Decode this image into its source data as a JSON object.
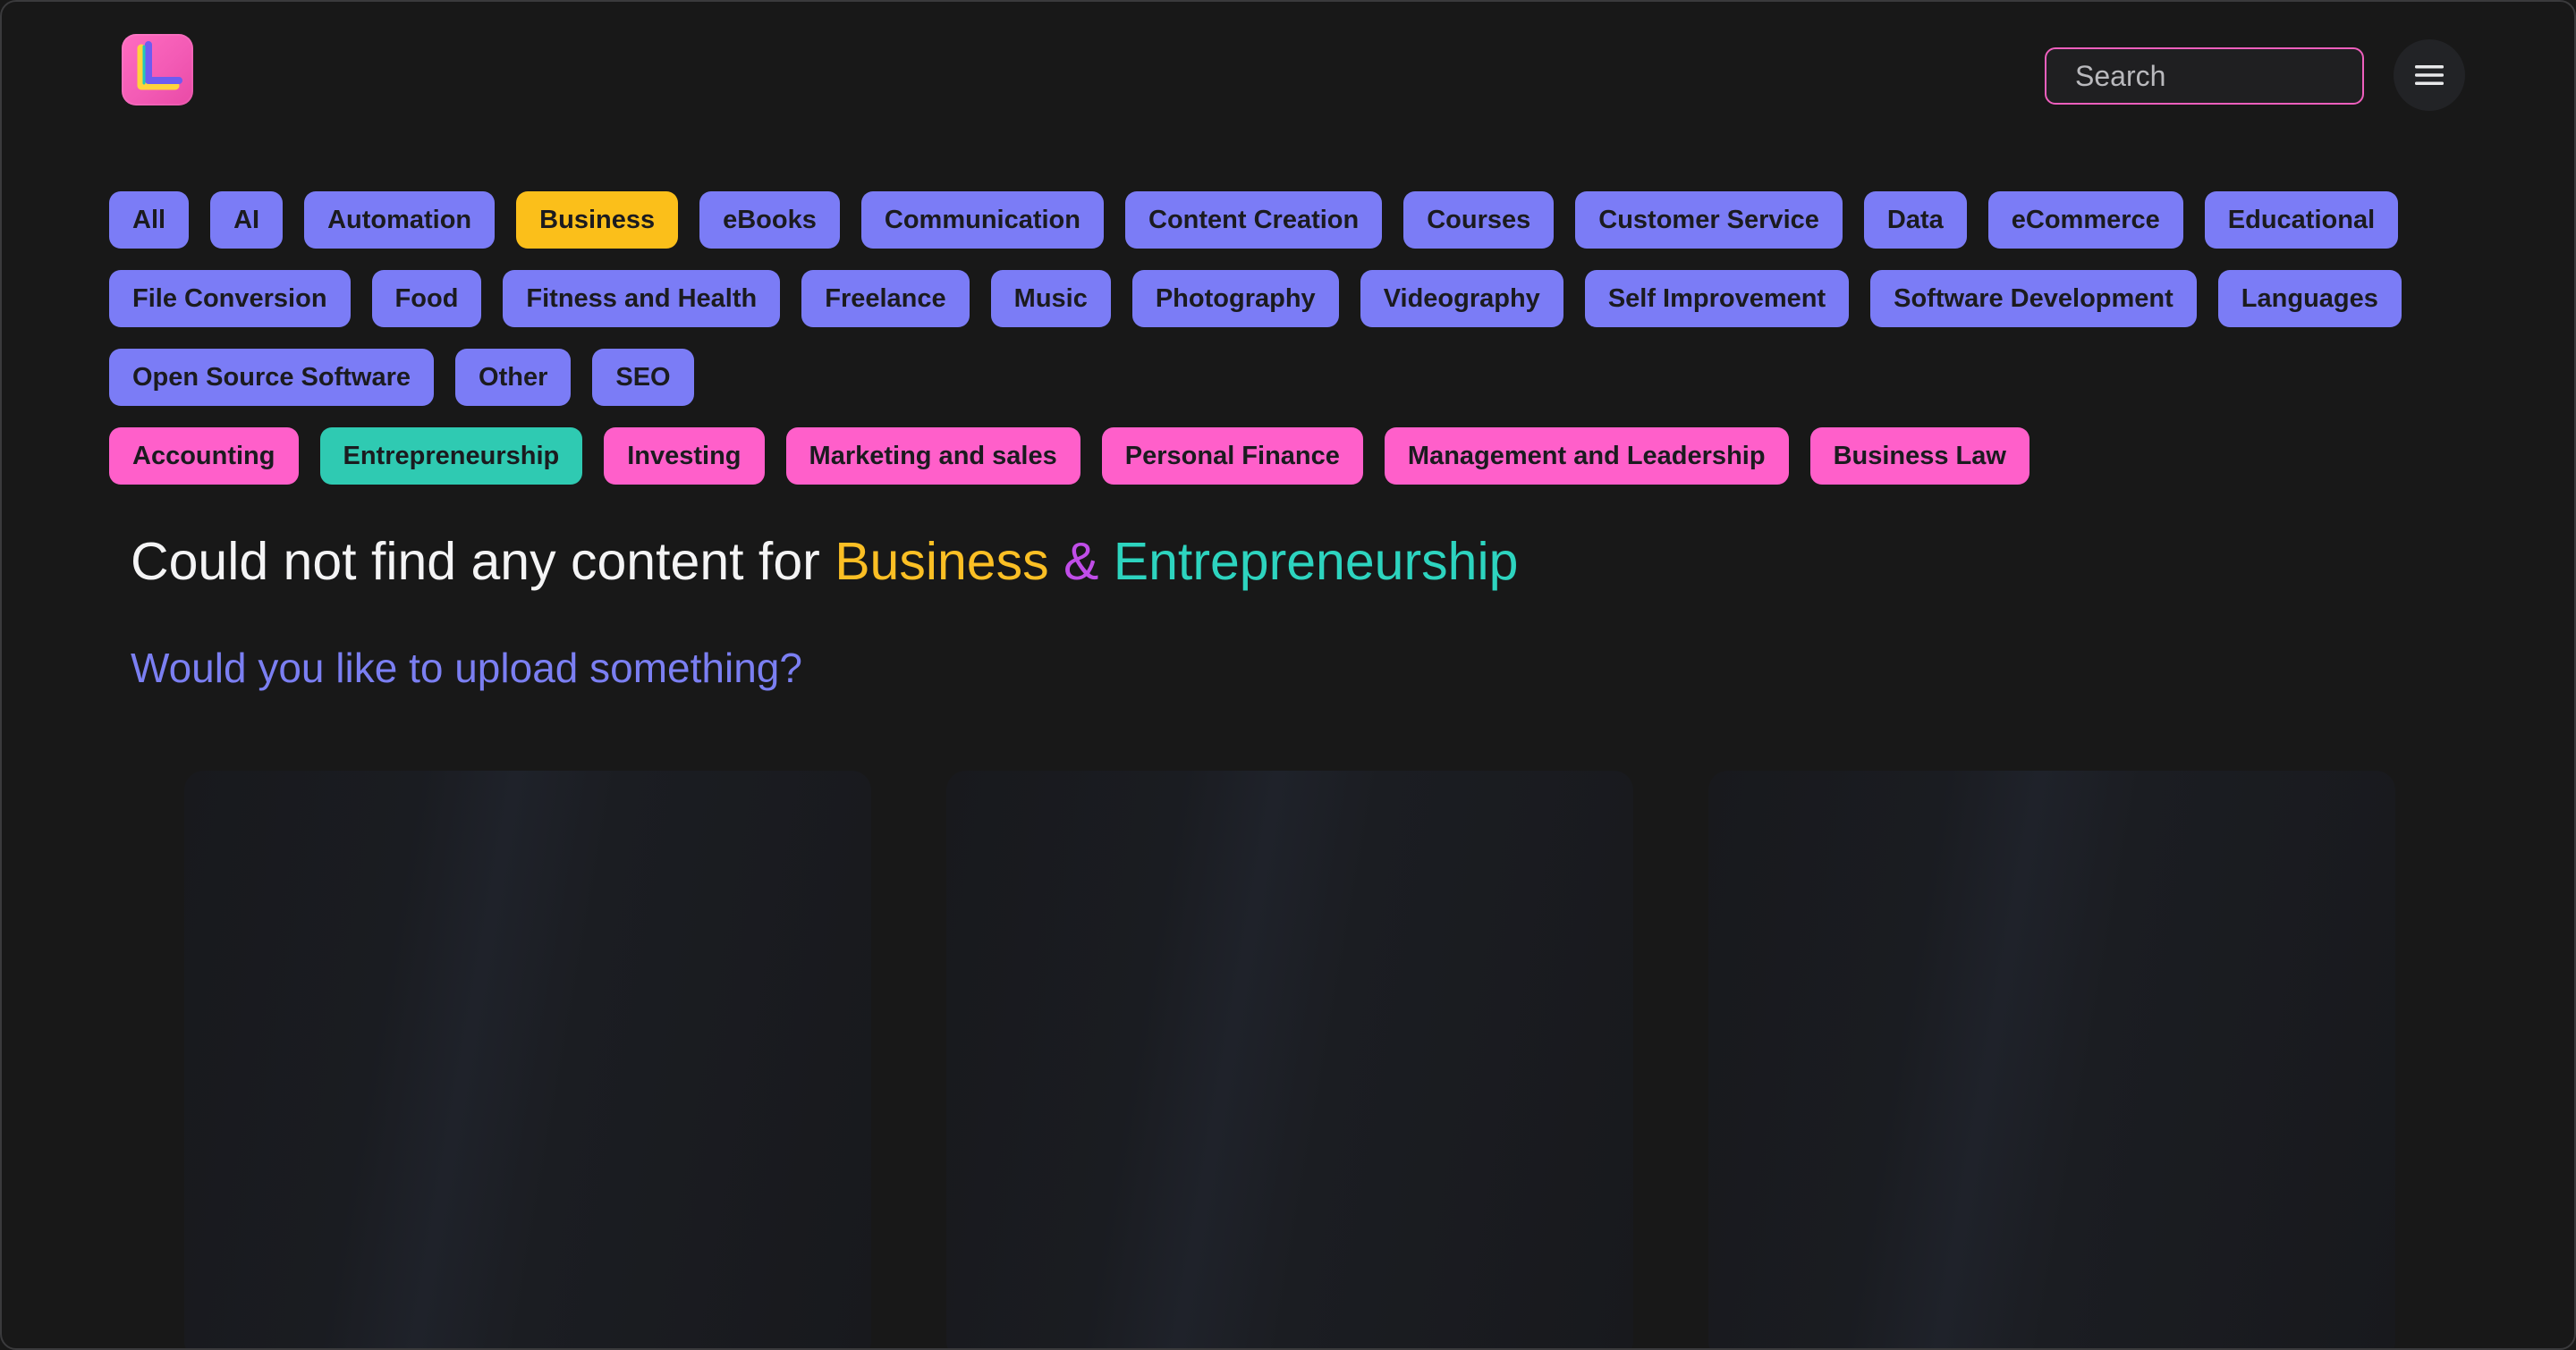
{
  "header": {
    "logo_letter": "L",
    "search": {
      "placeholder": "Search",
      "value": ""
    },
    "menu_icon": "hamburger-menu-icon"
  },
  "category_rows": [
    [
      {
        "label": "All",
        "state": "default"
      },
      {
        "label": "AI",
        "state": "default"
      },
      {
        "label": "Automation",
        "state": "default"
      },
      {
        "label": "Business",
        "state": "selected"
      },
      {
        "label": "eBooks",
        "state": "default"
      },
      {
        "label": "Communication",
        "state": "default"
      },
      {
        "label": "Content Creation",
        "state": "default"
      },
      {
        "label": "Courses",
        "state": "default"
      },
      {
        "label": "Customer Service",
        "state": "default"
      },
      {
        "label": "Data",
        "state": "default"
      },
      {
        "label": "eCommerce",
        "state": "default"
      },
      {
        "label": "Educational",
        "state": "default"
      }
    ],
    [
      {
        "label": "File Conversion",
        "state": "default"
      },
      {
        "label": "Food",
        "state": "default"
      },
      {
        "label": "Fitness and Health",
        "state": "default"
      },
      {
        "label": "Freelance",
        "state": "default"
      },
      {
        "label": "Music",
        "state": "default"
      },
      {
        "label": "Photography",
        "state": "default"
      },
      {
        "label": "Videography",
        "state": "default"
      },
      {
        "label": "Self Improvement",
        "state": "default"
      },
      {
        "label": "Software Development",
        "state": "default"
      },
      {
        "label": "Languages",
        "state": "default"
      }
    ],
    [
      {
        "label": "Open Source Software",
        "state": "default"
      },
      {
        "label": "Other",
        "state": "default"
      },
      {
        "label": "SEO",
        "state": "default"
      }
    ]
  ],
  "subcategories": [
    {
      "label": "Accounting",
      "state": "default"
    },
    {
      "label": "Entrepreneurship",
      "state": "selected"
    },
    {
      "label": "Investing",
      "state": "default"
    },
    {
      "label": "Marketing and sales",
      "state": "default"
    },
    {
      "label": "Personal Finance",
      "state": "default"
    },
    {
      "label": "Management and Leadership",
      "state": "default"
    },
    {
      "label": "Business Law",
      "state": "default"
    }
  ],
  "empty_state": {
    "prefix": "Could not find any content for",
    "category": "Business",
    "ampersand": "&",
    "subcategory": "Entrepreneurship",
    "upload_prompt": "Would you like to upload something?"
  },
  "colors": {
    "background": "#181818",
    "tag_default": "#7b7cf6",
    "tag_selected_category": "#fbbf1a",
    "tag_subcategory": "#ff5fca",
    "tag_selected_subcategory": "#2fcab2",
    "upload_prompt": "#7b7ff2",
    "search_border": "#ee5fbd"
  },
  "skeleton_cards": 3
}
